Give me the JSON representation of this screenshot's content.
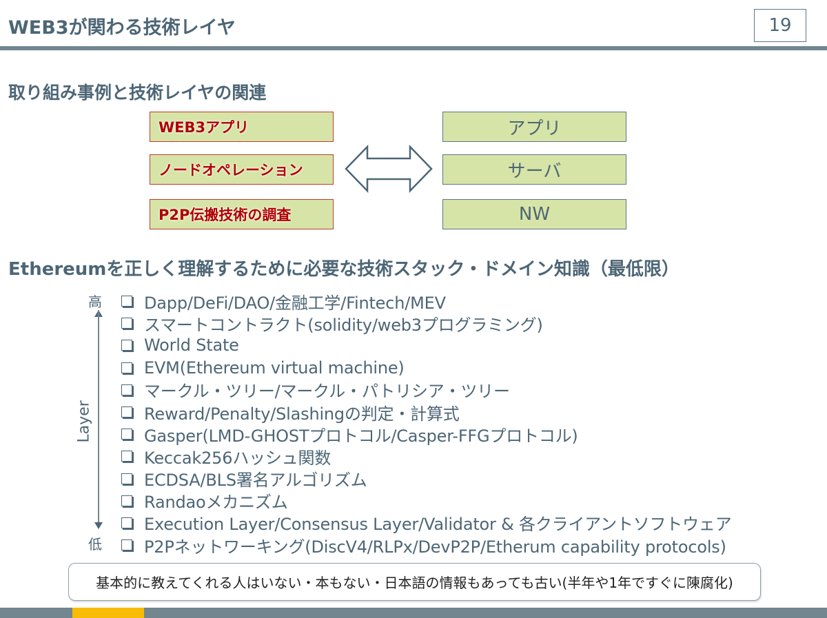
{
  "header": {
    "title": "WEB3が関わる技術レイヤ",
    "page_number": "19"
  },
  "section1": {
    "title": "取り組み事例と技術レイヤの関連",
    "cases": [
      {
        "label": "WEB3アプリ"
      },
      {
        "label": "ノードオペレーション"
      },
      {
        "label": "P2P伝搬技術の調査"
      }
    ],
    "layers": [
      {
        "label": "アプリ"
      },
      {
        "label": "サーバ"
      },
      {
        "label": "NW"
      }
    ],
    "relation_icon": "double-arrow-icon"
  },
  "section2": {
    "title": "Ethereumを正しく理解するために必要な技術スタック・ドメイン知識（最低限）",
    "axis": {
      "label": "Layer",
      "high": "高",
      "low": "低"
    },
    "items": [
      {
        "label": "Dapp/DeFi/DAO/金融工学/Fintech/MEV"
      },
      {
        "label": "スマートコントラクト(solidity/web3プログラミング)"
      },
      {
        "label": "World State"
      },
      {
        "label": "EVM(Ethereum virtual machine)"
      },
      {
        "label": "マークル・ツリー/マークル・パトリシア・ツリー"
      },
      {
        "label": "Reward/Penalty/Slashingの判定・計算式"
      },
      {
        "label": "Gasper(LMD-GHOSTプロトコル/Casper-FFGプロトコル)"
      },
      {
        "label": "Keccak256ハッシュ関数"
      },
      {
        "label": "ECDSA/BLS署名アルゴリズム"
      },
      {
        "label": "Randaoメカニズム"
      },
      {
        "label": "Execution Layer/Consensus Layer/Validator & 各クライアントソフトウェア"
      },
      {
        "label": "P2Pネットワーキング(DiscV4/RLPx/DevP2P/Etherum capability protocols)"
      }
    ]
  },
  "note": {
    "text": "基本的に教えてくれる人はいない・本もない・日本語の情報もあっても古い(半年や1年ですぐに陳腐化)"
  },
  "colors": {
    "text_primary": "#4d6676",
    "accent_red": "#b00000",
    "box_fill": "#d7e4a7",
    "rule": "#6f8591",
    "footer_accent": "#f8bc06"
  }
}
